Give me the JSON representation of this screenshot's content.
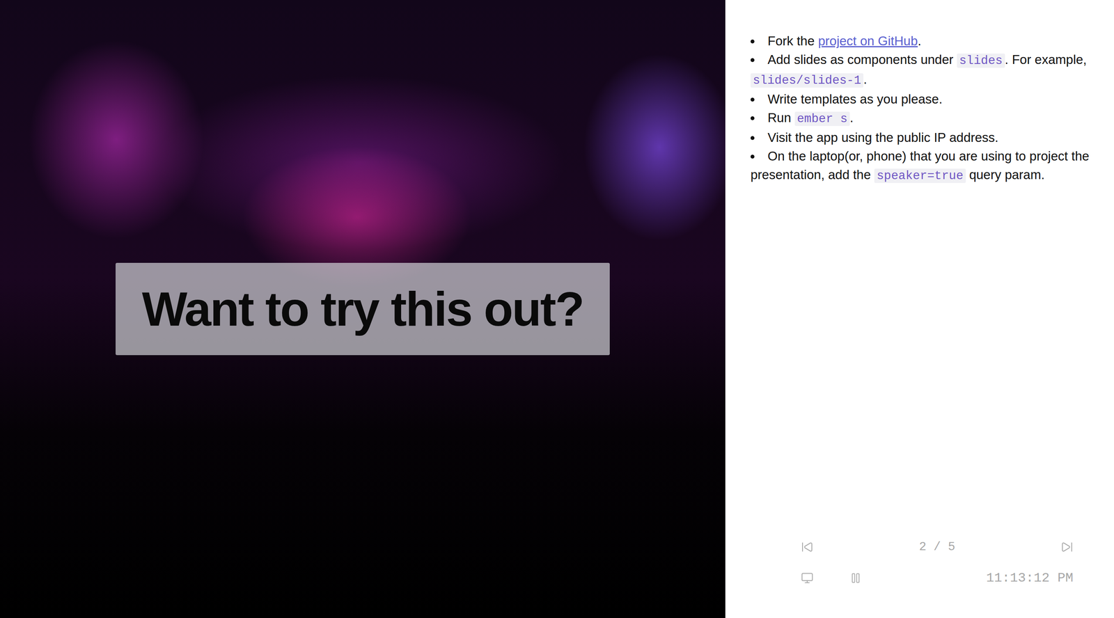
{
  "slide": {
    "title": "Want to try this out?"
  },
  "notes": [
    [
      {
        "kind": "text",
        "text": "Fork the "
      },
      {
        "kind": "link",
        "text": "project on GitHub"
      },
      {
        "kind": "text",
        "text": "."
      }
    ],
    [
      {
        "kind": "text",
        "text": "Add slides as components under "
      },
      {
        "kind": "code",
        "text": "slides"
      },
      {
        "kind": "text",
        "text": ". For example, "
      },
      {
        "kind": "code",
        "text": "slides/slides-1"
      },
      {
        "kind": "text",
        "text": "."
      }
    ],
    [
      {
        "kind": "text",
        "text": "Write templates as you please."
      }
    ],
    [
      {
        "kind": "text",
        "text": "Run "
      },
      {
        "kind": "code",
        "text": "ember s"
      },
      {
        "kind": "text",
        "text": "."
      }
    ],
    [
      {
        "kind": "text",
        "text": "Visit the app using the public IP address."
      }
    ],
    [
      {
        "kind": "text",
        "text": "On the laptop(or, phone) that you are using to project the presentation, add the "
      },
      {
        "kind": "code",
        "text": "speaker=true"
      },
      {
        "kind": "text",
        "text": " query param."
      }
    ]
  ],
  "controls": {
    "counter": "2 / 5",
    "time": "11:13:12 PM",
    "timer_running": true
  }
}
